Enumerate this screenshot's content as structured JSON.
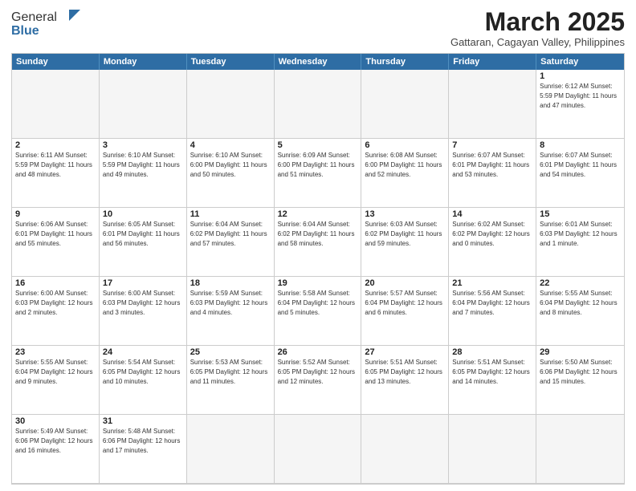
{
  "header": {
    "logo_general": "General",
    "logo_blue": "Blue",
    "month_title": "March 2025",
    "subtitle": "Gattaran, Cagayan Valley, Philippines"
  },
  "day_headers": [
    "Sunday",
    "Monday",
    "Tuesday",
    "Wednesday",
    "Thursday",
    "Friday",
    "Saturday"
  ],
  "cells": [
    {
      "date": "",
      "info": "",
      "empty": true
    },
    {
      "date": "",
      "info": "",
      "empty": true
    },
    {
      "date": "",
      "info": "",
      "empty": true
    },
    {
      "date": "",
      "info": "",
      "empty": true
    },
    {
      "date": "",
      "info": "",
      "empty": true
    },
    {
      "date": "",
      "info": "",
      "empty": true
    },
    {
      "date": "1",
      "info": "Sunrise: 6:12 AM\nSunset: 5:59 PM\nDaylight: 11 hours\nand 47 minutes."
    },
    {
      "date": "2",
      "info": "Sunrise: 6:11 AM\nSunset: 5:59 PM\nDaylight: 11 hours\nand 48 minutes."
    },
    {
      "date": "3",
      "info": "Sunrise: 6:10 AM\nSunset: 5:59 PM\nDaylight: 11 hours\nand 49 minutes."
    },
    {
      "date": "4",
      "info": "Sunrise: 6:10 AM\nSunset: 6:00 PM\nDaylight: 11 hours\nand 50 minutes."
    },
    {
      "date": "5",
      "info": "Sunrise: 6:09 AM\nSunset: 6:00 PM\nDaylight: 11 hours\nand 51 minutes."
    },
    {
      "date": "6",
      "info": "Sunrise: 6:08 AM\nSunset: 6:00 PM\nDaylight: 11 hours\nand 52 minutes."
    },
    {
      "date": "7",
      "info": "Sunrise: 6:07 AM\nSunset: 6:01 PM\nDaylight: 11 hours\nand 53 minutes."
    },
    {
      "date": "8",
      "info": "Sunrise: 6:07 AM\nSunset: 6:01 PM\nDaylight: 11 hours\nand 54 minutes."
    },
    {
      "date": "9",
      "info": "Sunrise: 6:06 AM\nSunset: 6:01 PM\nDaylight: 11 hours\nand 55 minutes."
    },
    {
      "date": "10",
      "info": "Sunrise: 6:05 AM\nSunset: 6:01 PM\nDaylight: 11 hours\nand 56 minutes."
    },
    {
      "date": "11",
      "info": "Sunrise: 6:04 AM\nSunset: 6:02 PM\nDaylight: 11 hours\nand 57 minutes."
    },
    {
      "date": "12",
      "info": "Sunrise: 6:04 AM\nSunset: 6:02 PM\nDaylight: 11 hours\nand 58 minutes."
    },
    {
      "date": "13",
      "info": "Sunrise: 6:03 AM\nSunset: 6:02 PM\nDaylight: 11 hours\nand 59 minutes."
    },
    {
      "date": "14",
      "info": "Sunrise: 6:02 AM\nSunset: 6:02 PM\nDaylight: 12 hours\nand 0 minutes."
    },
    {
      "date": "15",
      "info": "Sunrise: 6:01 AM\nSunset: 6:03 PM\nDaylight: 12 hours\nand 1 minute."
    },
    {
      "date": "16",
      "info": "Sunrise: 6:00 AM\nSunset: 6:03 PM\nDaylight: 12 hours\nand 2 minutes."
    },
    {
      "date": "17",
      "info": "Sunrise: 6:00 AM\nSunset: 6:03 PM\nDaylight: 12 hours\nand 3 minutes."
    },
    {
      "date": "18",
      "info": "Sunrise: 5:59 AM\nSunset: 6:03 PM\nDaylight: 12 hours\nand 4 minutes."
    },
    {
      "date": "19",
      "info": "Sunrise: 5:58 AM\nSunset: 6:04 PM\nDaylight: 12 hours\nand 5 minutes."
    },
    {
      "date": "20",
      "info": "Sunrise: 5:57 AM\nSunset: 6:04 PM\nDaylight: 12 hours\nand 6 minutes."
    },
    {
      "date": "21",
      "info": "Sunrise: 5:56 AM\nSunset: 6:04 PM\nDaylight: 12 hours\nand 7 minutes."
    },
    {
      "date": "22",
      "info": "Sunrise: 5:55 AM\nSunset: 6:04 PM\nDaylight: 12 hours\nand 8 minutes."
    },
    {
      "date": "23",
      "info": "Sunrise: 5:55 AM\nSunset: 6:04 PM\nDaylight: 12 hours\nand 9 minutes."
    },
    {
      "date": "24",
      "info": "Sunrise: 5:54 AM\nSunset: 6:05 PM\nDaylight: 12 hours\nand 10 minutes."
    },
    {
      "date": "25",
      "info": "Sunrise: 5:53 AM\nSunset: 6:05 PM\nDaylight: 12 hours\nand 11 minutes."
    },
    {
      "date": "26",
      "info": "Sunrise: 5:52 AM\nSunset: 6:05 PM\nDaylight: 12 hours\nand 12 minutes."
    },
    {
      "date": "27",
      "info": "Sunrise: 5:51 AM\nSunset: 6:05 PM\nDaylight: 12 hours\nand 13 minutes."
    },
    {
      "date": "28",
      "info": "Sunrise: 5:51 AM\nSunset: 6:05 PM\nDaylight: 12 hours\nand 14 minutes."
    },
    {
      "date": "29",
      "info": "Sunrise: 5:50 AM\nSunset: 6:06 PM\nDaylight: 12 hours\nand 15 minutes."
    },
    {
      "date": "30",
      "info": "Sunrise: 5:49 AM\nSunset: 6:06 PM\nDaylight: 12 hours\nand 16 minutes."
    },
    {
      "date": "31",
      "info": "Sunrise: 5:48 AM\nSunset: 6:06 PM\nDaylight: 12 hours\nand 17 minutes."
    },
    {
      "date": "",
      "info": "",
      "empty": true
    },
    {
      "date": "",
      "info": "",
      "empty": true
    },
    {
      "date": "",
      "info": "",
      "empty": true
    },
    {
      "date": "",
      "info": "",
      "empty": true
    },
    {
      "date": "",
      "info": "",
      "empty": true
    }
  ]
}
